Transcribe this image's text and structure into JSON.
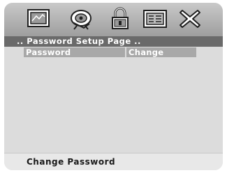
{
  "toolbar": {
    "icons": [
      "general-setup-icon",
      "audio-setup-icon",
      "password-lock-icon",
      "preference-icon",
      "exit-icon"
    ],
    "selected": "password-lock-icon"
  },
  "page": {
    "title": ".. Password Setup Page .."
  },
  "menu": {
    "items": [
      {
        "label": "Password",
        "value": "Change"
      }
    ]
  },
  "status": {
    "text": "Change Password"
  },
  "colors": {
    "toolbar_top": "#c9c9c9",
    "toolbar_bottom": "#9e9e9e",
    "title_bar": "#6a6a6a",
    "body_bg": "#dcdcdc",
    "highlight": "#a8a8a8",
    "status_bg": "#e8e8e8"
  }
}
